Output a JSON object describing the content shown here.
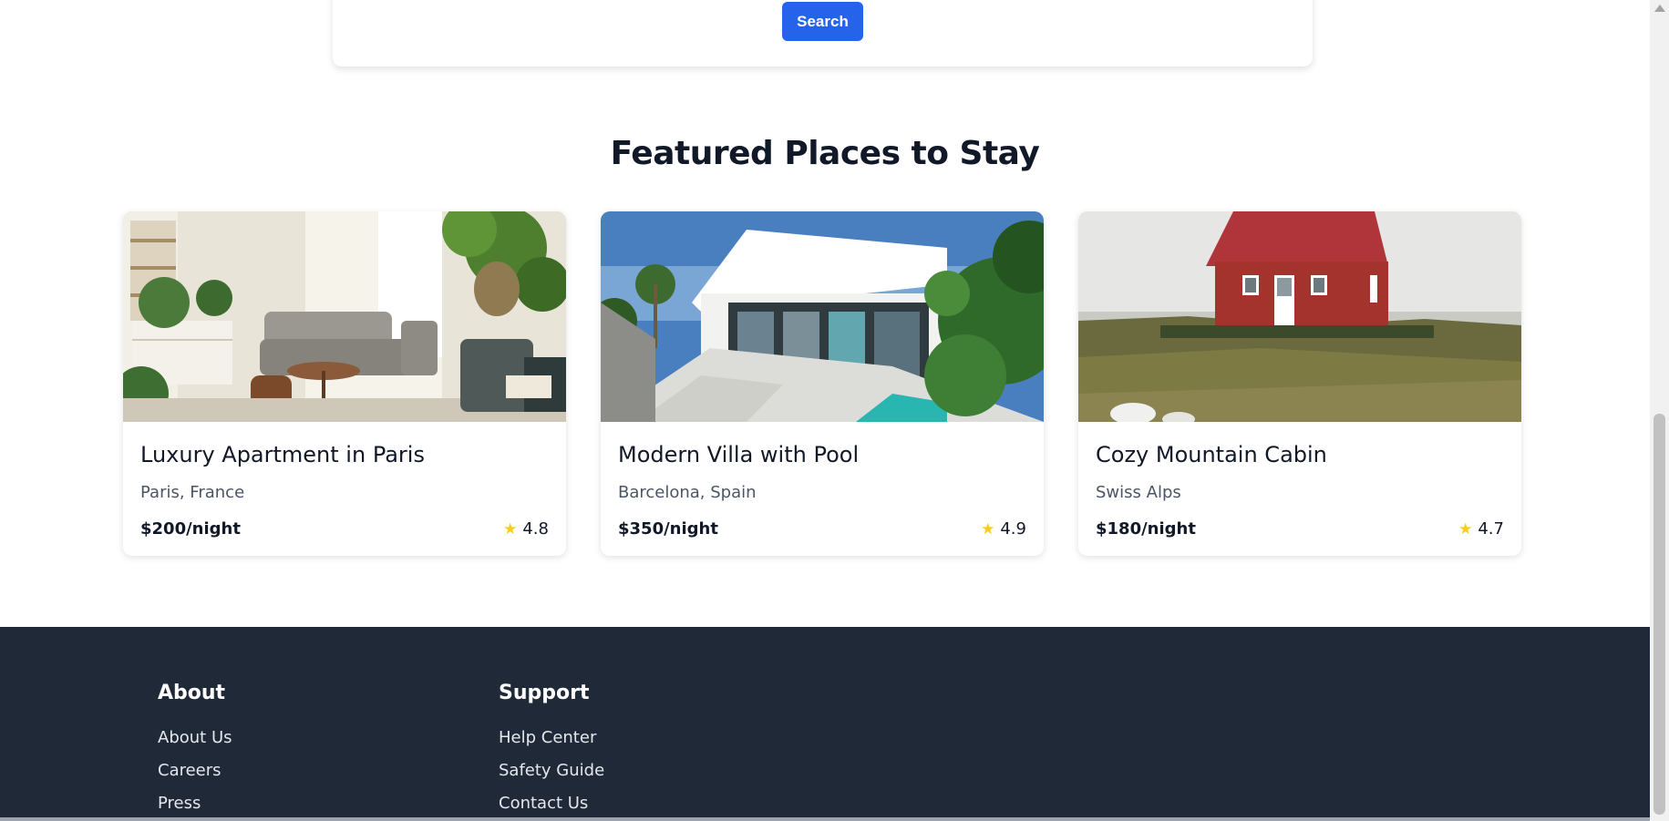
{
  "search": {
    "button_label": "Search"
  },
  "featured": {
    "title": "Featured Places to Stay",
    "cards": [
      {
        "title": "Luxury Apartment in Paris",
        "location": "Paris, France",
        "price": "$200/night",
        "rating": "4.8",
        "image": "apartment-living-room-photo"
      },
      {
        "title": "Modern Villa with Pool",
        "location": "Barcelona, Spain",
        "price": "$350/night",
        "rating": "4.9",
        "image": "modern-villa-pool-photo"
      },
      {
        "title": "Cozy Mountain Cabin",
        "location": "Swiss Alps",
        "price": "$180/night",
        "rating": "4.7",
        "image": "red-cabin-hill-photo"
      }
    ],
    "star_icon": "star-icon",
    "star_color": "#facc15"
  },
  "footer": {
    "columns": [
      {
        "heading": "About",
        "links": [
          "About Us",
          "Careers",
          "Press"
        ]
      },
      {
        "heading": "Support",
        "links": [
          "Help Center",
          "Safety Guide",
          "Contact Us"
        ]
      }
    ]
  },
  "colors": {
    "accent": "#2563eb",
    "footer_bg": "#1f2937"
  }
}
